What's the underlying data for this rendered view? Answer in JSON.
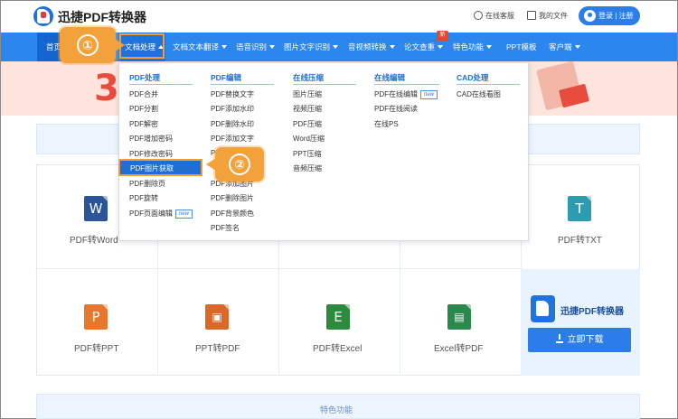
{
  "header": {
    "brand": "迅捷PDF转换器",
    "service_label": "在线客服",
    "files_label": "我的文件",
    "login_label": "登录 | 注册"
  },
  "nav": {
    "items": [
      {
        "label": "首页"
      },
      {
        "label": "文档处理"
      },
      {
        "label": "文档文本翻译"
      },
      {
        "label": "语音识别"
      },
      {
        "label": "图片文字识别"
      },
      {
        "label": "音视频转换"
      },
      {
        "label": "论文查重"
      },
      {
        "label": "特色功能"
      },
      {
        "label": "PPT模板"
      },
      {
        "label": "客户端"
      }
    ],
    "new_badge": "新"
  },
  "callouts": {
    "step1": "①",
    "step2": "②"
  },
  "banner": {
    "big_text": "3"
  },
  "dropdown": {
    "columns": [
      {
        "heading": "PDF处理",
        "items": [
          "PDF合并",
          "PDF分割",
          "PDF解密",
          "PDF增加密码",
          "PDF修改密码",
          "PDF图片获取",
          "PDF删除页",
          "PDF旋转",
          "PDF页面编辑"
        ],
        "new_on": "PDF页面编辑"
      },
      {
        "heading": "PDF编辑",
        "items": [
          "PDF替换文字",
          "PDF添加水印",
          "PDF删除水印",
          "PDF添加文字",
          "PDF",
          "",
          "PDF添加图片",
          "PDF删除图片",
          "PDF背景颜色",
          "PDF签名"
        ]
      },
      {
        "heading": "在线压缩",
        "items": [
          "图片压缩",
          "视频压缩",
          "PDF压缩",
          "Word压缩",
          "PPT压缩",
          "音频压缩"
        ]
      },
      {
        "heading": "在线编辑",
        "items": [
          "PDF在线编辑",
          "PDF在线阅读",
          "在线PS"
        ],
        "new_on": "PDF在线编辑"
      },
      {
        "heading": "CAD处理",
        "items": [
          "CAD在线看图"
        ]
      }
    ],
    "new_tag": "new",
    "selected": "PDF图片获取"
  },
  "tools": [
    {
      "label": "PDF转Word",
      "glyph": "W",
      "color": "#2a5699"
    },
    {
      "label": "PDF转TXT",
      "glyph": "T",
      "color": "#2d9bb0"
    },
    {
      "label": "PDF转PPT",
      "glyph": "P",
      "color": "#e8772e"
    },
    {
      "label": "PPT转PDF",
      "glyph": "▣",
      "color": "#d9692b"
    },
    {
      "label": "PDF转Excel",
      "glyph": "E",
      "color": "#2e8b3e"
    },
    {
      "label": "Excel转PDF",
      "glyph": "▤",
      "color": "#2b8a4b"
    }
  ],
  "promo": {
    "title": "迅捷PDF转换器",
    "download_label": "立即下载"
  },
  "features_label": "特色功能"
}
